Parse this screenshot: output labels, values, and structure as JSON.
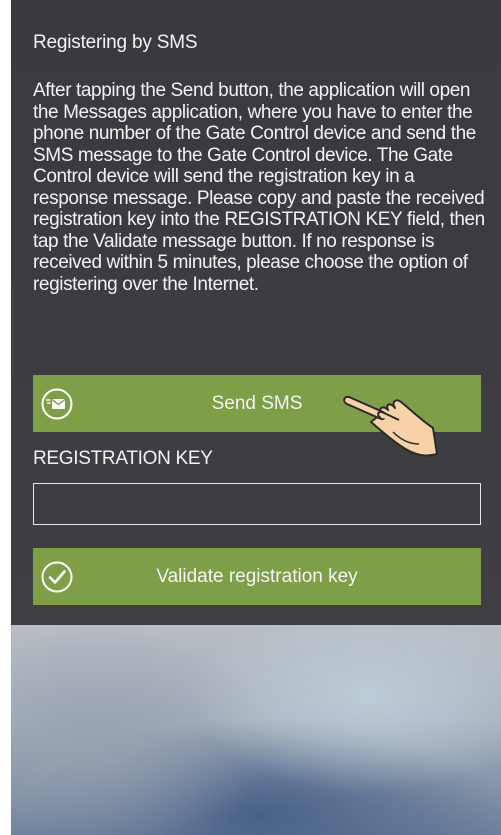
{
  "section": {
    "title": "Registering by SMS",
    "description": "After tapping the Send button, the application will open the Messages application, where you have to enter the phone number of the Gate Control device and send the SMS message to the Gate Control device. The Gate Control device will send the registration key in a response message. Please copy and paste the received registration key into the REGISTRATION KEY field, then tap the Validate message button. If no response is received within 5 minutes, please choose the option of registering over the Internet."
  },
  "send_sms": {
    "label": "Send SMS",
    "icon": "sms-envelope-icon"
  },
  "registration_key": {
    "label": "REGISTRATION KEY",
    "value": "",
    "placeholder": ""
  },
  "validate": {
    "label": "Validate registration key",
    "icon": "checkmark-circle-icon"
  },
  "pointer": {
    "icon": "tap-hand-icon"
  },
  "colors": {
    "button_green": "#7f9e48",
    "panel_dark": "#3f3e43",
    "text": "#f2f2f2"
  }
}
